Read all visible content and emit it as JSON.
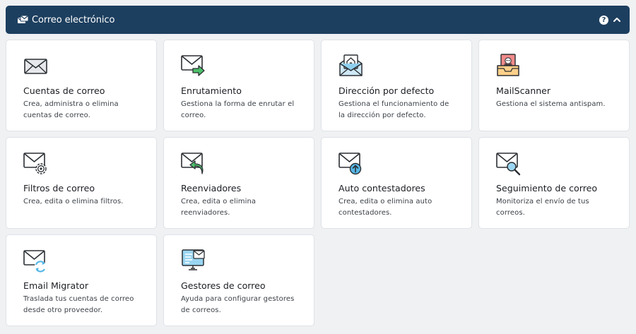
{
  "header": {
    "title": "Correo electrónico",
    "help_symbol": "?"
  },
  "cards": [
    {
      "title": "Cuentas de correo",
      "desc": "Crea, administra o elimina cuentas de correo.",
      "icon": "mail-envelope-icon"
    },
    {
      "title": "Enrutamiento",
      "desc": "Gestiona la forma de enrutar el correo.",
      "icon": "mail-routing-icon"
    },
    {
      "title": "Dirección por defecto",
      "desc": "Gestiona el funcionamiento de la dirección por defecto.",
      "icon": "default-address-icon"
    },
    {
      "title": "MailScanner",
      "desc": "Gestiona el sistema antispam.",
      "icon": "mailscanner-icon"
    },
    {
      "title": "Filtros de correo",
      "desc": "Crea, edita o elimina filtros.",
      "icon": "mail-filter-gear-icon"
    },
    {
      "title": "Reenviadores",
      "desc": "Crea, edita o elimina reenviadores.",
      "icon": "mail-forward-icon"
    },
    {
      "title": "Auto contestadores",
      "desc": "Crea, edita o elimina auto contestadores.",
      "icon": "autoresponder-icon"
    },
    {
      "title": "Seguimiento de correo",
      "desc": "Monitoriza el envío de tus correos.",
      "icon": "mail-tracking-icon"
    },
    {
      "title": "Email Migrator",
      "desc": "Traslada tus cuentas de correo desde otro proveedor.",
      "icon": "email-migrator-icon"
    },
    {
      "title": "Gestores de correo",
      "desc": "Ayuda para configurar gestores de correos.",
      "icon": "mail-clients-icon"
    }
  ],
  "colors": {
    "header_bg": "#1d3f5f",
    "page_bg": "#eff1f3",
    "accent_green": "#4cc06a",
    "accent_blue": "#56b7e6",
    "accent_red": "#e26a6a"
  }
}
